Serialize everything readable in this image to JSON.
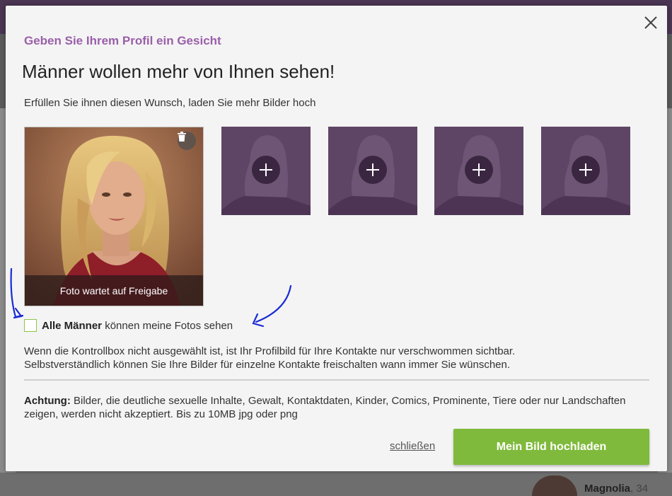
{
  "background": {
    "profile_name": "Magnolia",
    "profile_age": ", 34"
  },
  "modal": {
    "subtitle": "Geben Sie Ihrem Profil ein Gesicht",
    "title": "Männer wollen mehr von Ihnen sehen!",
    "intro": "Erfüllen Sie ihnen diesen Wunsch, laden Sie mehr Bilder hoch",
    "main_photo": {
      "status": "Foto wartet auf Freigabe"
    },
    "empty_slots": 4,
    "checkbox": {
      "checked": false,
      "label_bold": "Alle Männer",
      "label_rest": " können meine Fotos sehen"
    },
    "info_line1": "Wenn die Kontrollbox nicht ausgewählt ist, ist Ihr Profilbild für Ihre Kontakte nur verschwommen sichtbar.",
    "info_line2": "Selbstverständlich können Sie Ihre Bilder für einzelne Kontakte freischalten wann immer Sie wünschen.",
    "warning_bold": "Achtung:",
    "warning_text": " Bilder, die deutliche sexuelle Inhalte, Gewalt, Kontaktdaten, Kinder, Comics, Prominente, Tiere oder nur Landschaften zeigen, werden nicht akzeptiert. Bis zu 10MB jpg oder png",
    "close_link": "schließen",
    "upload_button": "Mein Bild hochladen"
  },
  "colors": {
    "accent_purple": "#9a5fa9",
    "slot_purple": "#5e4565",
    "upload_green": "#7fba3c",
    "annotation_blue": "#1a2bd4"
  },
  "icons": {
    "close": "close-icon",
    "trash": "trash-icon",
    "plus": "plus-icon",
    "silhouette": "silhouette-icon"
  }
}
